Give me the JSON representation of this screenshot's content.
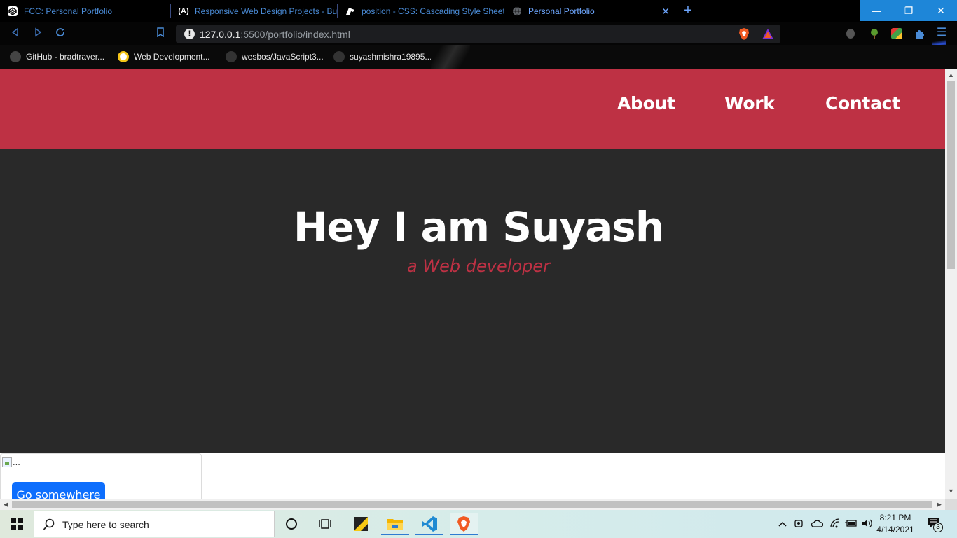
{
  "browser": {
    "tabs": [
      {
        "title": "FCC: Personal Portfolio"
      },
      {
        "title": "Responsive Web Design Projects - Bui"
      },
      {
        "title": "position - CSS: Cascading Style Sheets"
      },
      {
        "title": "Personal Portfolio"
      }
    ],
    "active_tab": 3,
    "new_tab_label": "+",
    "window_buttons": {
      "minimize": "—",
      "restore": "❐",
      "close": "✕"
    },
    "url_host": "127.0.0.1",
    "url_rest": ":5500/portfolio/index.html",
    "bookmarks": [
      {
        "label": "GitHub - bradtraver..."
      },
      {
        "label": "Web Development..."
      },
      {
        "label": "wesbos/JavaScript3..."
      },
      {
        "label": "suyashmishra19895..."
      }
    ]
  },
  "page": {
    "nav": {
      "about": "About",
      "work": "Work",
      "contact": "Contact"
    },
    "hero": {
      "title": "Hey I am Suyash",
      "subtitle": "a Web developer"
    },
    "card": {
      "image_alt": "...",
      "button": "Go somewhere"
    }
  },
  "taskbar": {
    "search_placeholder": "Type here to search",
    "time": "8:21 PM",
    "date": "4/14/2021",
    "notification_count": "3"
  },
  "colors": {
    "brand_red": "#be3144",
    "hero_bg": "#292929",
    "button_blue": "#0d6efd"
  }
}
